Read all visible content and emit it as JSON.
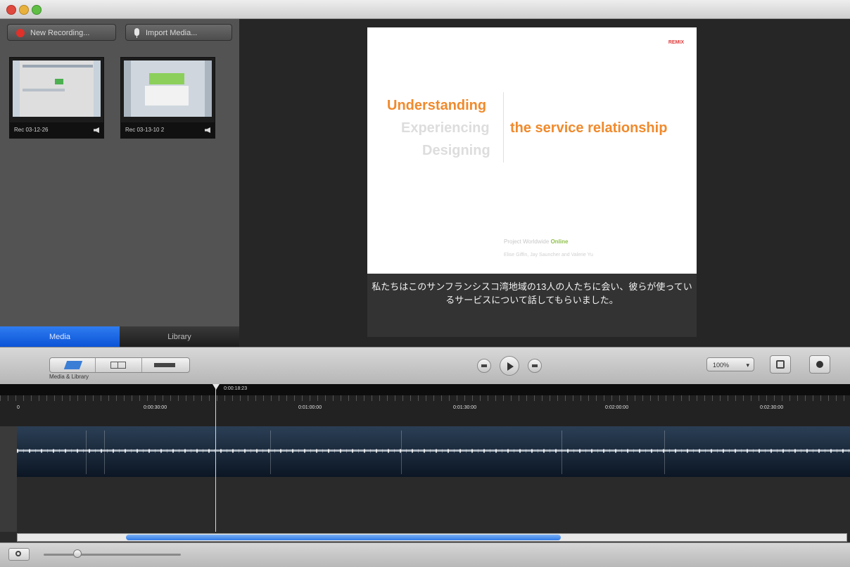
{
  "library_panel": {
    "new_recording_label": "New Recording...",
    "import_media_label": "Import Media...",
    "thumbnails": [
      {
        "caption": "Rec 03-12-26"
      },
      {
        "caption": "Rec 03-13-10 2"
      }
    ],
    "tabs": [
      "Media",
      "Library"
    ],
    "active_tab": "Media"
  },
  "preview": {
    "slide": {
      "logo_text": "REMIX",
      "word_1": "Understanding",
      "word_2": "Experiencing",
      "word_3": "Designing",
      "headline": "the service relationship",
      "footer_prefix": "Project Worldwide",
      "footer_accent": "Online",
      "footer_names": "Elise Giffin, Jay Sauncher and Valerie Yu"
    },
    "subtitle": "私たちはこのサンフランシスコ湾地域の13人の人たちに会い、彼らが使っているサービスについて話してもらいました。"
  },
  "toolbar": {
    "view_caption": "Media & Library",
    "zoom_value": "100%"
  },
  "timeline": {
    "playhead_time": "0:00:18:23",
    "ruler_labels": [
      "0",
      "0:00:30:00",
      "0:01:00:00",
      "0:01:30:00",
      "0:02:00:00",
      "0:02:30:00"
    ]
  },
  "colors": {
    "accent_blue": "#0a52d6",
    "slide_orange": "#f08a2c",
    "record_red": "#e0302a"
  },
  "icons": [
    "record-icon",
    "microphone-icon",
    "speaker-icon",
    "rewind-icon",
    "play-icon",
    "fast-forward-icon",
    "swap-icon",
    "gear-icon",
    "magnifier-icon"
  ]
}
